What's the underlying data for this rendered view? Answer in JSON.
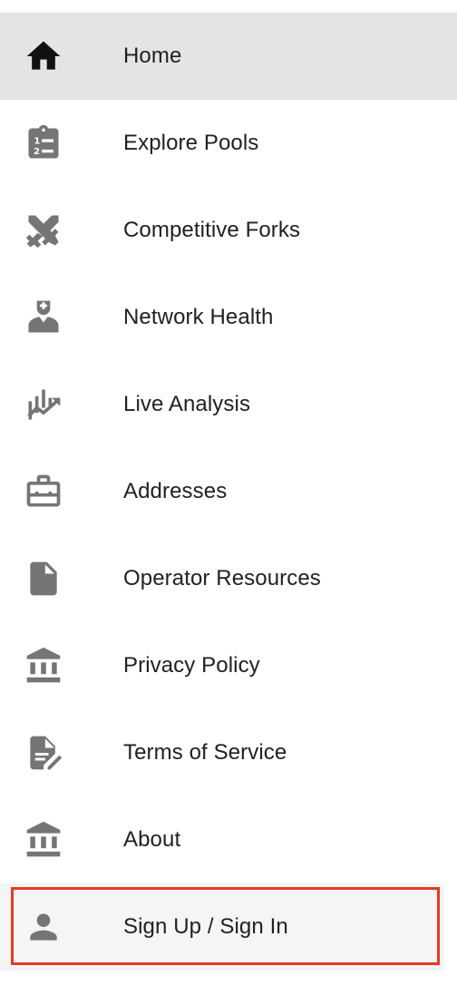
{
  "nav": {
    "items": [
      {
        "label": "Home",
        "icon": "home-icon",
        "active": true
      },
      {
        "label": "Explore Pools",
        "icon": "clipboard-list-icon"
      },
      {
        "label": "Competitive Forks",
        "icon": "crossed-swords-icon"
      },
      {
        "label": "Network Health",
        "icon": "doctor-icon"
      },
      {
        "label": "Live Analysis",
        "icon": "chart-trend-icon"
      },
      {
        "label": "Addresses",
        "icon": "briefcase-icon"
      },
      {
        "label": "Operator Resources",
        "icon": "document-icon"
      },
      {
        "label": "Privacy Policy",
        "icon": "bank-icon"
      },
      {
        "label": "Terms of Service",
        "icon": "document-edit-icon"
      },
      {
        "label": "About",
        "icon": "bank-icon"
      }
    ],
    "signin": {
      "label": "Sign Up / Sign In",
      "icon": "person-icon",
      "highlight_color": "#e53a22"
    }
  },
  "colors": {
    "icon": "#757575",
    "active_icon": "#111111",
    "active_bg": "#e4e4e4",
    "text": "#212121"
  }
}
